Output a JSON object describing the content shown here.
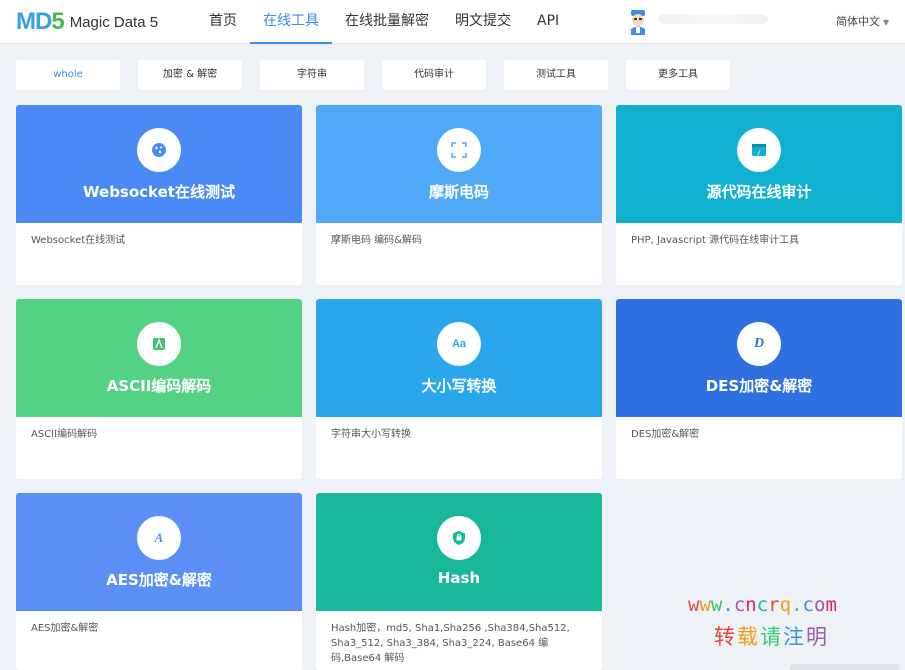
{
  "header": {
    "logo_mark_a": "MD",
    "logo_mark_b": "5",
    "logo_text": "Magic Data 5",
    "nav": [
      {
        "label": "首页",
        "active": false
      },
      {
        "label": "在线工具",
        "active": true
      },
      {
        "label": "在线批量解密",
        "active": false
      },
      {
        "label": "明文提交",
        "active": false
      },
      {
        "label": "API",
        "active": false
      }
    ],
    "language": "简体中文"
  },
  "filters": [
    {
      "label": "whole",
      "active": true
    },
    {
      "label": "加密 & 解密",
      "active": false
    },
    {
      "label": "字符串",
      "active": false
    },
    {
      "label": "代码审计",
      "active": false
    },
    {
      "label": "测试工具",
      "active": false
    },
    {
      "label": "更多工具",
      "active": false
    }
  ],
  "cards": [
    {
      "title": "Websocket在线测试",
      "desc": "Websocket在线测试",
      "color": "#4a8af4",
      "icon": "cookie-icon",
      "icon_color": "#4a8af4"
    },
    {
      "title": "摩斯电码",
      "desc": "摩斯电码 编码&解码",
      "color": "#4fa9f7",
      "icon": "scan-icon",
      "icon_color": "#4fa9f7"
    },
    {
      "title": "源代码在线审计",
      "desc": "PHP, Javascript 源代码在线审计工具",
      "color": "#0fb1cf",
      "icon": "code-window-icon",
      "icon_color": "#0fb1cf"
    },
    {
      "title": "ASCII编码解码",
      "desc": "ASCII编码解码",
      "color": "#53d283",
      "icon": "ascii-icon",
      "icon_color": "#3ec473"
    },
    {
      "title": "大小写转换",
      "desc": "字符串大小写转换",
      "color": "#2aa7ec",
      "icon": "case-icon",
      "icon_color": "#2aa7ec",
      "icon_text": "Aa"
    },
    {
      "title": "DES加密&解密",
      "desc": "DES加密&解密",
      "color": "#2f70e1",
      "icon": "des-icon",
      "icon_color": "#2f70e1",
      "icon_text": "D"
    },
    {
      "title": "AES加密&解密",
      "desc": "AES加密&解密",
      "color": "#5b8ff6",
      "icon": "aes-icon",
      "icon_color": "#5b8ff6",
      "icon_text": "A"
    },
    {
      "title": "Hash",
      "desc": "Hash加密，md5, Sha1,Sha256 ,Sha384,Sha512, Sha3_512, Sha3_384, Sha3_224, Base64 编码,Base64 解码",
      "color": "#19b79a",
      "icon": "shield-icon",
      "icon_color": "#19b79a"
    }
  ],
  "watermark": {
    "line1": "www.cncrq.com",
    "line2": "转载请注明"
  }
}
